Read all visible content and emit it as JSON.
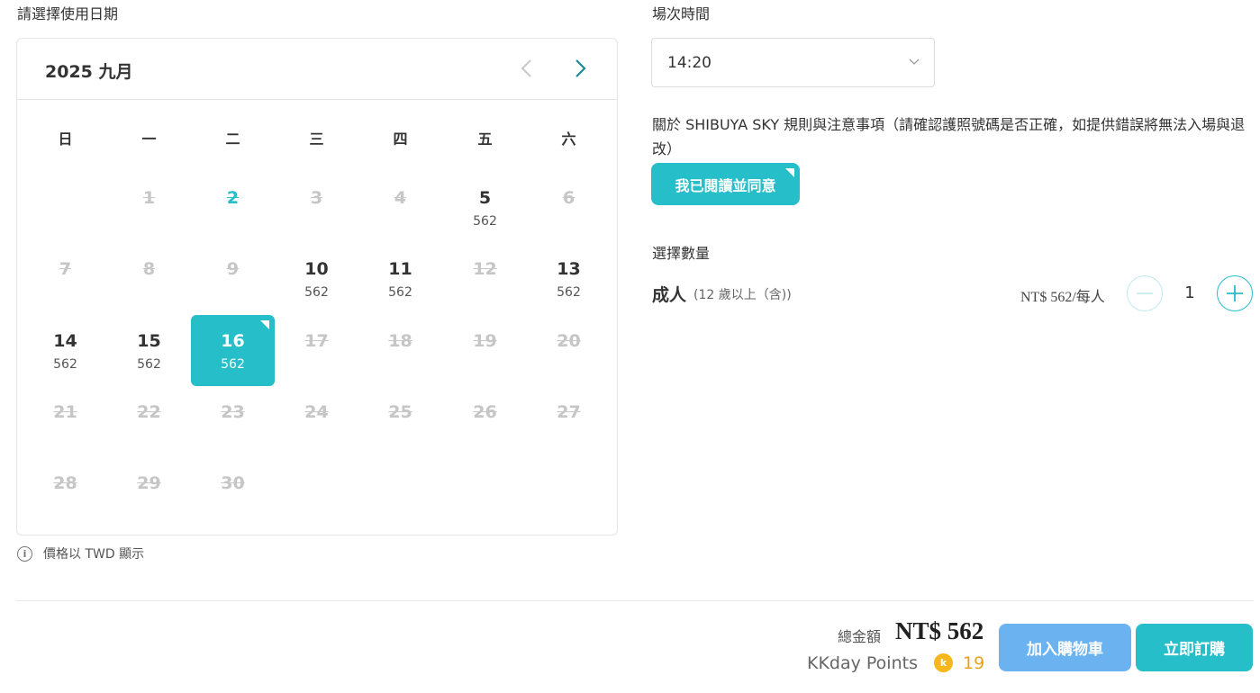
{
  "date_section": {
    "label": "請選擇使用日期"
  },
  "calendar": {
    "title": "2025 九月",
    "weekdays": [
      "日",
      "一",
      "二",
      "三",
      "四",
      "五",
      "六"
    ],
    "days": [
      {
        "day": "1",
        "price": "",
        "status": "disabled"
      },
      {
        "day": "2",
        "price": "",
        "status": "disabled-today"
      },
      {
        "day": "3",
        "price": "",
        "status": "disabled"
      },
      {
        "day": "4",
        "price": "",
        "status": "disabled"
      },
      {
        "day": "5",
        "price": "562",
        "status": "available"
      },
      {
        "day": "6",
        "price": "",
        "status": "disabled"
      },
      {
        "day": "7",
        "price": "",
        "status": "disabled"
      },
      {
        "day": "8",
        "price": "",
        "status": "disabled"
      },
      {
        "day": "9",
        "price": "",
        "status": "disabled"
      },
      {
        "day": "10",
        "price": "562",
        "status": "available"
      },
      {
        "day": "11",
        "price": "562",
        "status": "available"
      },
      {
        "day": "12",
        "price": "",
        "status": "disabled"
      },
      {
        "day": "13",
        "price": "562",
        "status": "available"
      },
      {
        "day": "14",
        "price": "562",
        "status": "available"
      },
      {
        "day": "15",
        "price": "562",
        "status": "available"
      },
      {
        "day": "16",
        "price": "562",
        "status": "selected"
      },
      {
        "day": "17",
        "price": "",
        "status": "disabled"
      },
      {
        "day": "18",
        "price": "",
        "status": "disabled"
      },
      {
        "day": "19",
        "price": "",
        "status": "disabled"
      },
      {
        "day": "20",
        "price": "",
        "status": "disabled"
      },
      {
        "day": "21",
        "price": "",
        "status": "disabled"
      },
      {
        "day": "22",
        "price": "",
        "status": "disabled"
      },
      {
        "day": "23",
        "price": "",
        "status": "disabled"
      },
      {
        "day": "24",
        "price": "",
        "status": "disabled"
      },
      {
        "day": "25",
        "price": "",
        "status": "disabled"
      },
      {
        "day": "26",
        "price": "",
        "status": "disabled"
      },
      {
        "day": "27",
        "price": "",
        "status": "disabled"
      },
      {
        "day": "28",
        "price": "",
        "status": "disabled"
      },
      {
        "day": "29",
        "price": "",
        "status": "disabled"
      },
      {
        "day": "30",
        "price": "",
        "status": "disabled"
      }
    ],
    "first_weekday_index": 1,
    "price_note": "價格以 TWD 顯示"
  },
  "time_section": {
    "label": "場次時間",
    "selected_time": "14:20"
  },
  "rules": {
    "text": "關於 SHIBUYA SKY 規則與注意事項（請確認護照號碼是否正確，如提供錯誤將無法入場與退改）",
    "agree_button": "我已閱讀並同意"
  },
  "quantity": {
    "label": "選擇數量",
    "ticket_name": "成人",
    "ticket_age": "(12 歲以上（含))",
    "unit_price": "NT$ 562/每人",
    "value": "1"
  },
  "footer": {
    "total_label": "總金額",
    "total_value": "NT$ 562",
    "points_label": "KKday Points",
    "points_coin": "k",
    "points_value": "19",
    "add_cart_label": "加入購物車",
    "book_now_label": "立即訂購"
  },
  "colors": {
    "accent": "#26bec9",
    "cart_blue": "#6bb3f0",
    "points_gold": "#f5b71b",
    "disabled_text": "#c6c6c6"
  },
  "icons": {
    "prev": "chevron-left-icon",
    "next": "chevron-right-icon",
    "dropdown": "chevron-down-icon",
    "info": "info-icon",
    "minus": "minus-icon",
    "plus": "plus-icon"
  }
}
